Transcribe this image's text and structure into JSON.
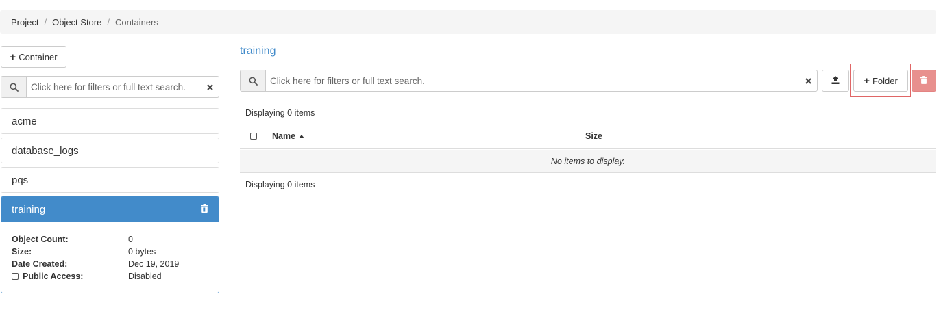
{
  "breadcrumb": {
    "items": [
      "Project",
      "Object Store"
    ],
    "separator": "/",
    "current": "Containers"
  },
  "sidebar": {
    "add_container_label": "Container",
    "search": {
      "placeholder": "Click here for filters or full text search."
    },
    "containers": [
      "acme",
      "database_logs",
      "pqs"
    ],
    "selected": {
      "name": "training",
      "details": {
        "object_count_label": "Object Count:",
        "object_count": "0",
        "size_label": "Size:",
        "size": "0 bytes",
        "date_created_label": "Date Created:",
        "date_created": "Dec 19, 2019",
        "public_access_label": "Public Access:",
        "public_access": "Disabled"
      }
    }
  },
  "main": {
    "title": "training",
    "search": {
      "placeholder": "Click here for filters or full text search."
    },
    "folder_button_label": "Folder",
    "count_top": "Displaying 0 items",
    "count_bottom": "Displaying 0 items",
    "table": {
      "columns": [
        "Name",
        "Size"
      ],
      "empty_message": "No items to display."
    }
  },
  "colors": {
    "primary": "#428bca",
    "danger": "#e8908e",
    "highlight": "#e06666"
  }
}
